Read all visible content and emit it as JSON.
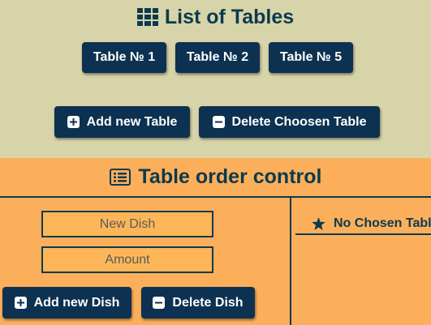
{
  "tables_section": {
    "title": "List of Tables",
    "title_icon": "th-grid-icon",
    "tables": [
      {
        "label": "Table № 1"
      },
      {
        "label": "Table № 2"
      },
      {
        "label": "Table № 5"
      }
    ],
    "add_label": "Add new Table",
    "delete_label": "Delete Choosen Table"
  },
  "order_section": {
    "title": "Table order control",
    "title_icon": "list-alt-icon",
    "dish_placeholder": "New Dish",
    "amount_placeholder": "Amount",
    "add_dish_label": "Add new Dish",
    "delete_dish_label": "Delete Dish",
    "chosen_table_text": "No Chosen Table"
  },
  "colors": {
    "top_background": "#d8d4aa",
    "bottom_background": "#fcaf5b",
    "button": "#0d3150",
    "text_dark": "#0c3a4e"
  }
}
